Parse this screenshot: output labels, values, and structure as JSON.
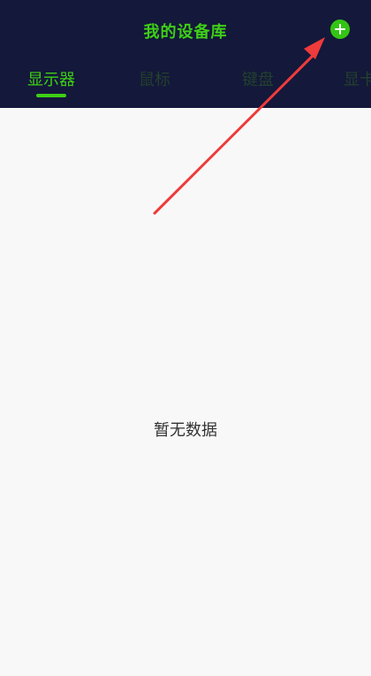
{
  "header": {
    "title": "我的设备库"
  },
  "tabs": [
    {
      "label": "显示器",
      "active": true
    },
    {
      "label": "鼠标",
      "active": false
    },
    {
      "label": "键盘",
      "active": false
    },
    {
      "label": "显卡",
      "active": false
    }
  ],
  "empty_state": {
    "text": "暂无数据"
  },
  "colors": {
    "header_bg": "#14183a",
    "accent": "#3ecf16",
    "page_bg": "#f8f8f8",
    "annotation_arrow": "#ee3b3b"
  },
  "icons": {
    "add": "plus-circle-icon",
    "annotation": "red-arrow-icon"
  }
}
